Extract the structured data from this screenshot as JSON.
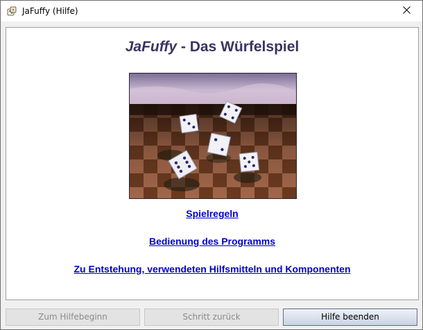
{
  "window": {
    "title": "JaFuffy (Hilfe)",
    "icons": [
      "app-dice-icon",
      "close-icon"
    ]
  },
  "page": {
    "title_brand": "JaFuffy",
    "title_rest": " - Das Würfelspiel"
  },
  "links": [
    {
      "label": "Spielregeln"
    },
    {
      "label": "Bedienung des Programms"
    },
    {
      "label": "Zu Entstehung, verwendeten Hilfsmitteln und Komponenten"
    }
  ],
  "buttons": {
    "home": "Zum Hilfebeginn",
    "back": "Schritt zurück",
    "close": "Hilfe beenden"
  },
  "colors": {
    "heading": "#3c3363",
    "link": "#0000cc"
  }
}
